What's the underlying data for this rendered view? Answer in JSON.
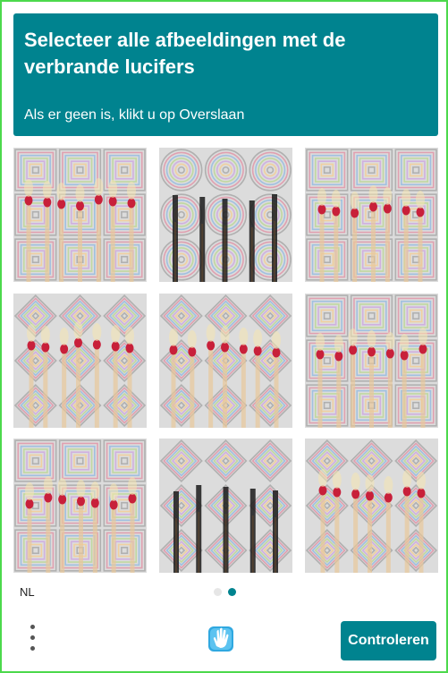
{
  "challenge": {
    "title": "Selecteer alle afbeeldingen met de verbrande lucifers",
    "subtitle": "Als er geen is, klikt u op Overslaan"
  },
  "tiles": [
    {
      "id": 1,
      "pattern": "squares",
      "subject": "match-heads-red"
    },
    {
      "id": 2,
      "pattern": "circles",
      "subject": "burnt-matches"
    },
    {
      "id": 3,
      "pattern": "squares",
      "subject": "match-heads-red"
    },
    {
      "id": 4,
      "pattern": "diamonds",
      "subject": "match-heads-red"
    },
    {
      "id": 5,
      "pattern": "diamonds",
      "subject": "match-heads-red"
    },
    {
      "id": 6,
      "pattern": "squares",
      "subject": "match-heads-red"
    },
    {
      "id": 7,
      "pattern": "squares",
      "subject": "match-heads-red"
    },
    {
      "id": 8,
      "pattern": "diamonds",
      "subject": "burnt-matches"
    },
    {
      "id": 9,
      "pattern": "diamonds",
      "subject": "match-heads-red"
    }
  ],
  "footer": {
    "language": "NL",
    "pager": {
      "total": 2,
      "current": 2
    },
    "submit_label": "Controleren",
    "menu_icon": "vertical-dots-icon",
    "logo_icon": "hand-logo-icon"
  },
  "colors": {
    "accent": "#00838f",
    "frame": "#4cd94c"
  }
}
